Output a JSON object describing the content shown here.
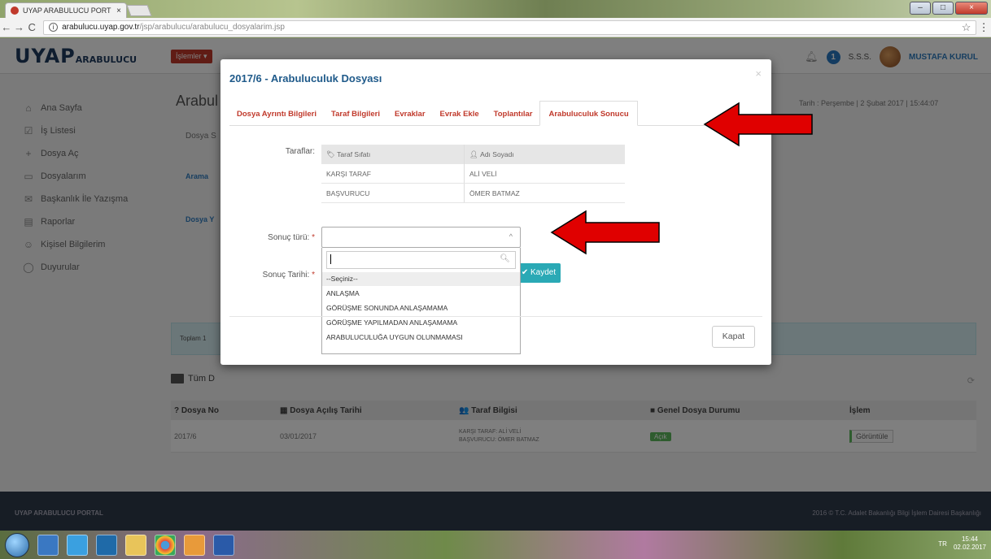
{
  "browser": {
    "tab_title": "UYAP ARABULUCU PORT",
    "tab_close": "×",
    "url_host": "arabulucu.uyap.gov.tr",
    "url_path": "/jsp/arabulucu/arabulucu_dosyalarim.jsp",
    "back": "←",
    "forward": "→",
    "reload": "C",
    "info": "i",
    "star": "☆",
    "menu": "⋮"
  },
  "header": {
    "logo_main": "UYAP",
    "logo_sub": "ARABULUCU",
    "islemler": "İşlemler ▾",
    "notif_count": "1",
    "sss": "S.S.S.",
    "user_name": "MUSTAFA KURUL"
  },
  "sidebar": {
    "items": [
      {
        "icon": "⌂",
        "label": "Ana Sayfa"
      },
      {
        "icon": "☑",
        "label": "İş Listesi"
      },
      {
        "icon": "+",
        "label": "Dosya Aç"
      },
      {
        "icon": "▭",
        "label": "Dosyalarım"
      },
      {
        "icon": "✉",
        "label": "Başkanlık İle Yazışma"
      },
      {
        "icon": "▤",
        "label": "Raporlar"
      },
      {
        "icon": "☺",
        "label": "Kişisel Bilgilerim"
      },
      {
        "icon": "◯",
        "label": "Duyurular"
      }
    ]
  },
  "content": {
    "title": "Arabul",
    "date_line": "Tarih : Perşembe | 2 Şubat 2017 | 15:44:07",
    "dosya_s": "Dosya S",
    "arama": "Arama",
    "dosya_y": "Dosya Y",
    "toplam": "Toplam 1",
    "tum_d": "Tüm D",
    "refresh": "⟳",
    "table": {
      "headers": [
        "? Dosya No",
        "▦ Dosya Açılış Tarihi",
        "👥 Taraf Bilgisi",
        "■ Genel Dosya Durumu",
        "İşlem"
      ],
      "rows": [
        {
          "no": "2017/6",
          "tarih": "03/01/2017",
          "taraf1": "KARŞI TARAF: ALİ VELİ",
          "taraf2": "BAŞVURUCU: ÖMER BATMAZ",
          "durum": "Açık",
          "islem": "Görüntüle"
        }
      ]
    }
  },
  "footer": {
    "left": "UYAP ARABULUCU PORTAL",
    "right": "2016 © T.C. Adalet Bakanlığı Bilgi İşlem Dairesi Başkanlığı"
  },
  "modal": {
    "title": "2017/6 - Arabuluculuk Dosyası",
    "close": "×",
    "tabs": [
      "Dosya Ayrıntı Bilgileri",
      "Taraf Bilgileri",
      "Evraklar",
      "Evrak Ekle",
      "Toplantılar",
      "Arabuluculuk Sonucu"
    ],
    "taraflar_label": "Taraflar:",
    "party_headers": [
      "Taraf Sıfatı",
      "Adı Soyadı"
    ],
    "parties": [
      {
        "sifat": "KARŞI TARAF",
        "ad": "ALİ VELİ"
      },
      {
        "sifat": "BAŞVURUCU",
        "ad": "ÖMER BATMAZ"
      }
    ],
    "sonuc_turu_label": "Sonuç türü:",
    "sonuc_tarihi_label": "Sonuç Tarihi:",
    "required_mark": "*",
    "select_value": "",
    "dropdown_search": "",
    "options": [
      "--Seçiniz--",
      "ANLAŞMA",
      "GÖRÜŞME SONUNDA ANLAŞAMAMA",
      "GÖRÜŞME YAPILMADAN ANLAŞAMAMA",
      "ARABULUCULUĞA UYGUN OLUNMAMASI"
    ],
    "kaydet": "✔ Kaydet",
    "kapat": "Kapat"
  },
  "taskbar": {
    "lang": "TR",
    "time": "15:44",
    "date": "02.02.2017"
  },
  "colors": {
    "accent_red": "#c0392b",
    "accent_blue": "#1f5a8a",
    "kaydet": "#2aa9b5",
    "arrow": "#e00000"
  }
}
